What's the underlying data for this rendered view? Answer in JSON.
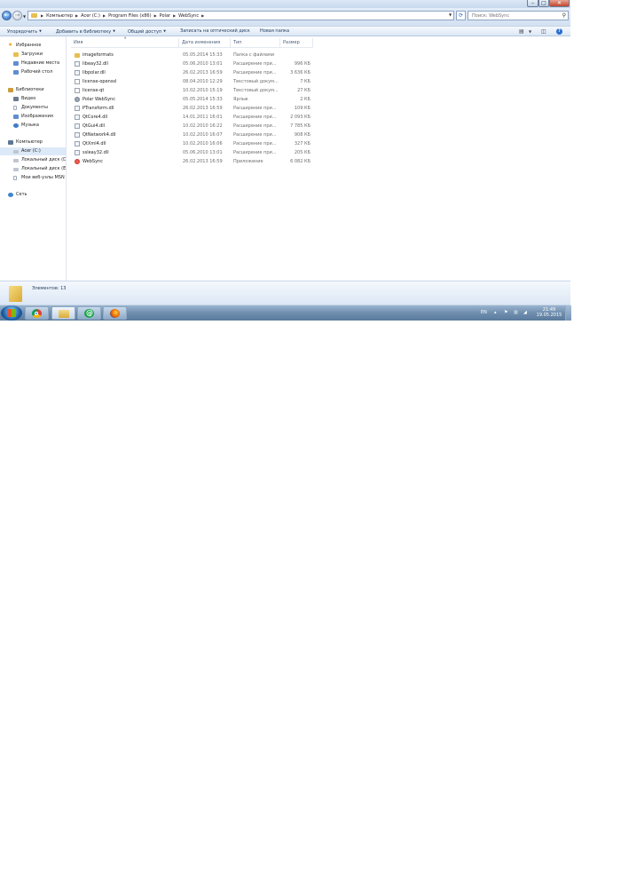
{
  "address": {
    "crumbs": [
      "Компьютер",
      "Acer (C:)",
      "Program Files (x86)",
      "Polar",
      "WebSync"
    ]
  },
  "search": {
    "placeholder": "Поиск: WebSync"
  },
  "toolbar": {
    "organize": "Упорядочить",
    "add_to_library": "Добавить в библиотеку",
    "share": "Общий доступ",
    "burn": "Записать на оптический диск",
    "new_folder": "Новая папка"
  },
  "navpane": {
    "favorites": "Избранное",
    "downloads": "Загрузки",
    "recent": "Недавние места",
    "desktop": "Рабочий стол",
    "libraries": "Библиотеки",
    "video": "Видео",
    "documents": "Документы",
    "images": "Изображения",
    "music": "Музыка",
    "computer": "Компьютер",
    "drive_c": "Acer (C:)",
    "drive_d": "Локальный диск (D:)",
    "drive_e": "Локальный диск (E:)",
    "msn": "Мои веб-узлы MSN",
    "network": "Сеть"
  },
  "columns": {
    "name": "Имя",
    "date": "Дата изменения",
    "type": "Тип",
    "size": "Размер"
  },
  "files": [
    {
      "name": "imageformats",
      "date": "05.05.2014 15:33",
      "type": "Папка с файлами",
      "size": "",
      "icon": "folder-icon"
    },
    {
      "name": "libeay32.dll",
      "date": "05.06.2010 13:01",
      "type": "Расширение при...",
      "size": "996 КБ",
      "icon": "dll-file-icon"
    },
    {
      "name": "libpolar.dll",
      "date": "26.02.2013 16:59",
      "type": "Расширение при...",
      "size": "3 636 КБ",
      "icon": "dll-file-icon"
    },
    {
      "name": "license-openssl",
      "date": "08.04.2010 12:29",
      "type": "Текстовый докум...",
      "size": "7 КБ",
      "icon": "text-file-icon"
    },
    {
      "name": "license-qt",
      "date": "10.02.2010 15:19",
      "type": "Текстовый докум...",
      "size": "27 КБ",
      "icon": "text-file-icon"
    },
    {
      "name": "Polar WebSync",
      "date": "05.05.2014 15:33",
      "type": "Ярлык",
      "size": "2 КБ",
      "icon": "shortcut-icon"
    },
    {
      "name": "PTransform.dll",
      "date": "26.02.2013 16:59",
      "type": "Расширение при...",
      "size": "109 КБ",
      "icon": "dll-file-icon"
    },
    {
      "name": "QtCore4.dll",
      "date": "14.01.2011 16:01",
      "type": "Расширение при...",
      "size": "2 093 КБ",
      "icon": "dll-file-icon"
    },
    {
      "name": "QtGui4.dll",
      "date": "10.02.2010 16:22",
      "type": "Расширение при...",
      "size": "7 785 КБ",
      "icon": "dll-file-icon"
    },
    {
      "name": "QtNetwork4.dll",
      "date": "10.02.2010 16:07",
      "type": "Расширение при...",
      "size": "908 КБ",
      "icon": "dll-file-icon"
    },
    {
      "name": "QtXml4.dll",
      "date": "10.02.2010 16:06",
      "type": "Расширение при...",
      "size": "327 КБ",
      "icon": "dll-file-icon"
    },
    {
      "name": "ssleay32.dll",
      "date": "05.06.2010 13:01",
      "type": "Расширение при...",
      "size": "205 КБ",
      "icon": "dll-file-icon"
    },
    {
      "name": "WebSync",
      "date": "26.02.2013 16:59",
      "type": "Приложение",
      "size": "6 082 КБ",
      "icon": "app-icon"
    }
  ],
  "details": {
    "count": "Элементов: 13"
  },
  "tray": {
    "lang": "EN",
    "time": "21:49",
    "date": "19.05.2015"
  }
}
